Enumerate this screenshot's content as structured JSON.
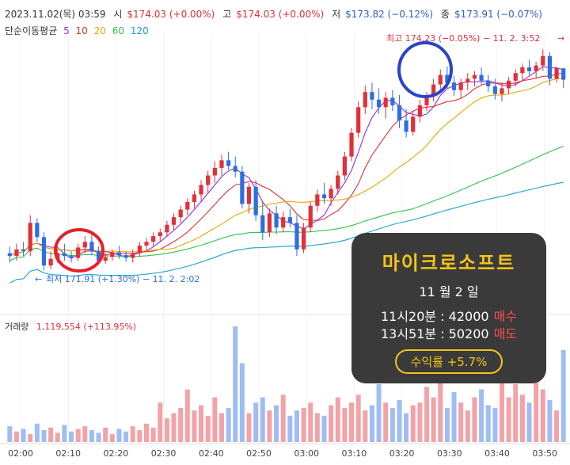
{
  "header": {
    "date": "2023.11.02(목) 03:59",
    "open_label": "시",
    "open_value": "$174.03 (+0.00%)",
    "high_label": "고",
    "high_value": "$174.03 (+0.00%)",
    "low_label": "저",
    "low_value": "$173.82 (−0.12%)",
    "close_label": "종",
    "close_value": "$173.91 (−0.07%)"
  },
  "ma": {
    "label": "단순이동평균",
    "periods": [
      {
        "text": "5",
        "color": "#9b2bd9"
      },
      {
        "text": "10",
        "color": "#e0303a"
      },
      {
        "text": "20",
        "color": "#e8a800"
      },
      {
        "text": "60",
        "color": "#2fc24a"
      },
      {
        "text": "120",
        "color": "#1aa0d8"
      }
    ]
  },
  "annotations": {
    "high": "최고 174.23 (−0.05%) − 11. 2. 3:52",
    "low": "최저 171.91 (+1.30%) − 11. 2. 2:02"
  },
  "volume": {
    "label": "거래량",
    "value": "1,119,554 (+113.95%)"
  },
  "panel": {
    "title": "마이크로소프트",
    "date": "11 월 2 일",
    "buy_text": "11시20분 : 42000",
    "buy_label": "매수",
    "sell_text": "13시51분 : 50200",
    "sell_label": "매도",
    "profit": "수익률 +5.7%"
  },
  "colors": {
    "up": "#e0303a",
    "down": "#2b6fe0",
    "up_vol": "#f2a3a8",
    "down_vol": "#9fbdf2",
    "circle_red": "#e8202a",
    "circle_blue": "#2a44c8"
  },
  "chart_data": {
    "type": "candlestick",
    "x_ticks": [
      "02:00",
      "02:10",
      "02:20",
      "02:30",
      "02:40",
      "02:50",
      "03:00",
      "03:10",
      "03:20",
      "03:30",
      "03:40",
      "03:50"
    ],
    "price_range": [
      171.45,
      174.4
    ],
    "candles": [
      [
        172.08,
        172.15,
        171.98,
        172.05
      ],
      [
        172.05,
        172.18,
        172.0,
        172.12
      ],
      [
        172.12,
        172.2,
        172.05,
        172.1
      ],
      [
        172.1,
        172.48,
        172.05,
        172.4
      ],
      [
        172.4,
        172.45,
        172.2,
        172.25
      ],
      [
        172.25,
        172.3,
        171.9,
        171.95
      ],
      [
        171.95,
        172.1,
        171.91,
        172.02
      ],
      [
        172.02,
        172.12,
        171.98,
        172.08
      ],
      [
        172.08,
        172.18,
        172.0,
        172.05
      ],
      [
        172.05,
        172.1,
        171.98,
        172.03
      ],
      [
        172.03,
        172.18,
        172.0,
        172.14
      ],
      [
        172.14,
        172.26,
        172.08,
        172.2
      ],
      [
        172.2,
        172.28,
        172.06,
        172.1
      ],
      [
        172.1,
        172.15,
        171.96,
        172.0
      ],
      [
        172.0,
        172.08,
        171.97,
        172.04
      ],
      [
        172.04,
        172.12,
        172.0,
        172.09
      ],
      [
        172.09,
        172.16,
        172.02,
        172.06
      ],
      [
        172.06,
        172.1,
        171.99,
        172.03
      ],
      [
        172.03,
        172.12,
        171.98,
        172.08
      ],
      [
        172.08,
        172.2,
        172.04,
        172.16
      ],
      [
        172.16,
        172.24,
        172.1,
        172.2
      ],
      [
        172.2,
        172.3,
        172.15,
        172.26
      ],
      [
        172.26,
        172.34,
        172.2,
        172.3
      ],
      [
        172.3,
        172.42,
        172.25,
        172.38
      ],
      [
        172.38,
        172.5,
        172.32,
        172.46
      ],
      [
        172.46,
        172.58,
        172.4,
        172.54
      ],
      [
        172.54,
        172.66,
        172.48,
        172.62
      ],
      [
        172.62,
        172.74,
        172.55,
        172.7
      ],
      [
        172.7,
        172.85,
        172.63,
        172.8
      ],
      [
        172.8,
        172.95,
        172.72,
        172.9
      ],
      [
        172.9,
        173.05,
        172.82,
        172.98
      ],
      [
        172.98,
        173.12,
        172.9,
        173.06
      ],
      [
        173.06,
        173.15,
        172.96,
        173.0
      ],
      [
        173.0,
        173.1,
        172.88,
        172.94
      ],
      [
        172.94,
        173.0,
        172.55,
        172.6
      ],
      [
        172.6,
        172.82,
        172.5,
        172.78
      ],
      [
        172.78,
        172.85,
        172.42,
        172.48
      ],
      [
        172.48,
        172.62,
        172.22,
        172.3
      ],
      [
        172.3,
        172.55,
        172.25,
        172.5
      ],
      [
        172.5,
        172.58,
        172.28,
        172.35
      ],
      [
        172.35,
        172.52,
        172.3,
        172.46
      ],
      [
        172.46,
        172.55,
        172.35,
        172.4
      ],
      [
        172.4,
        172.48,
        172.05,
        172.12
      ],
      [
        172.12,
        172.4,
        172.08,
        172.35
      ],
      [
        172.35,
        172.62,
        172.3,
        172.58
      ],
      [
        172.58,
        172.75,
        172.52,
        172.7
      ],
      [
        172.7,
        172.82,
        172.6,
        172.66
      ],
      [
        172.66,
        172.8,
        172.58,
        172.76
      ],
      [
        172.76,
        172.95,
        172.7,
        172.9
      ],
      [
        172.9,
        173.15,
        172.85,
        173.1
      ],
      [
        173.1,
        173.4,
        173.05,
        173.35
      ],
      [
        173.35,
        173.68,
        173.3,
        173.62
      ],
      [
        173.62,
        173.85,
        173.55,
        173.78
      ],
      [
        173.78,
        173.88,
        173.6,
        173.7
      ],
      [
        173.7,
        173.82,
        173.55,
        173.62
      ],
      [
        173.62,
        173.78,
        173.5,
        173.72
      ],
      [
        173.72,
        173.8,
        173.58,
        173.64
      ],
      [
        173.64,
        173.75,
        173.4,
        173.48
      ],
      [
        173.48,
        173.6,
        173.3,
        173.36
      ],
      [
        173.36,
        173.58,
        173.32,
        173.52
      ],
      [
        173.52,
        173.7,
        173.46,
        173.64
      ],
      [
        173.64,
        173.78,
        173.58,
        173.74
      ],
      [
        173.74,
        173.92,
        173.68,
        173.86
      ],
      [
        173.86,
        174.02,
        173.8,
        173.96
      ],
      [
        173.96,
        174.05,
        173.82,
        173.88
      ],
      [
        173.88,
        173.95,
        173.74,
        173.8
      ],
      [
        173.8,
        173.92,
        173.72,
        173.88
      ],
      [
        173.88,
        173.98,
        173.8,
        173.92
      ],
      [
        173.92,
        174.0,
        173.84,
        173.96
      ],
      [
        173.96,
        174.04,
        173.86,
        173.9
      ],
      [
        173.9,
        173.96,
        173.78,
        173.84
      ],
      [
        173.84,
        173.92,
        173.7,
        173.76
      ],
      [
        173.76,
        173.88,
        173.68,
        173.82
      ],
      [
        173.82,
        173.94,
        173.76,
        173.9
      ],
      [
        173.9,
        174.02,
        173.84,
        173.98
      ],
      [
        173.98,
        174.08,
        173.9,
        174.04
      ],
      [
        174.04,
        174.12,
        173.96,
        174.0
      ],
      [
        174.0,
        174.1,
        173.92,
        174.06
      ],
      [
        174.06,
        174.23,
        174.0,
        174.16
      ],
      [
        174.16,
        174.2,
        173.85,
        173.92
      ],
      [
        173.92,
        174.05,
        173.88,
        174.03
      ],
      [
        174.03,
        174.03,
        173.82,
        173.91
      ]
    ],
    "volumes": [
      12,
      8,
      10,
      6,
      14,
      9,
      11,
      7,
      13,
      8,
      10,
      12,
      9,
      7,
      11,
      6,
      10,
      8,
      12,
      9,
      14,
      11,
      30,
      18,
      22,
      26,
      40,
      24,
      28,
      20,
      34,
      22,
      26,
      88,
      60,
      22,
      30,
      34,
      24,
      28,
      36,
      20,
      24,
      26,
      30,
      22,
      20,
      28,
      34,
      26,
      30,
      36,
      24,
      28,
      44,
      30,
      26,
      32,
      22,
      28,
      30,
      42,
      34,
      46,
      26,
      38,
      30,
      24,
      34,
      40,
      28,
      26,
      56,
      34,
      44,
      36,
      30,
      60,
      40,
      32,
      24,
      70
    ]
  }
}
